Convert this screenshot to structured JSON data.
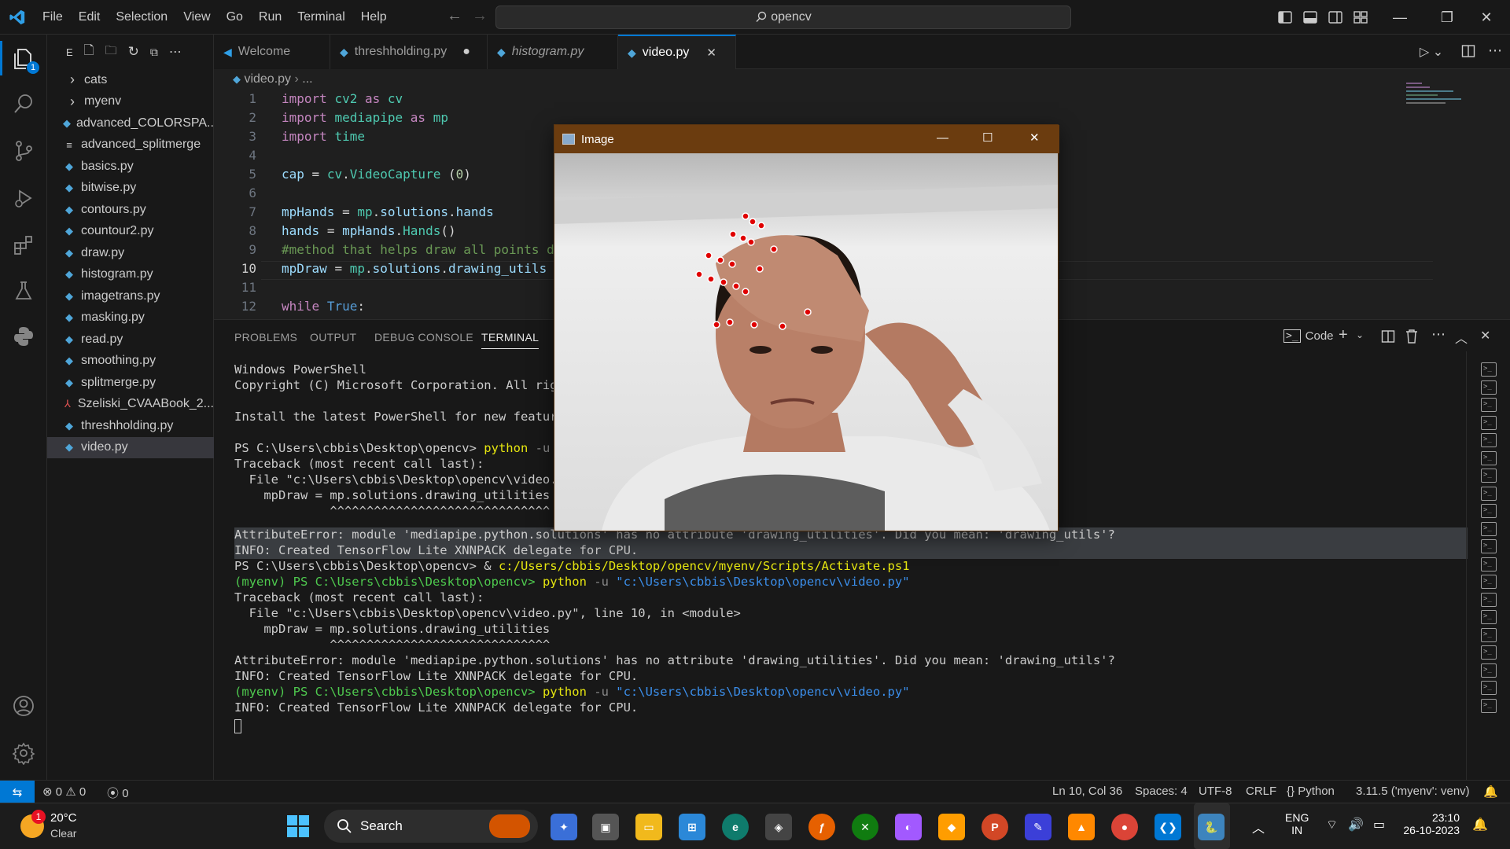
{
  "menu": [
    "File",
    "Edit",
    "Selection",
    "View",
    "Go",
    "Run",
    "Terminal",
    "Help"
  ],
  "command_center": "opencv",
  "sidebar": {
    "header_letter": "E",
    "items": [
      {
        "label": "cats",
        "kind": "folder"
      },
      {
        "label": "myenv",
        "kind": "folder"
      },
      {
        "label": "advanced_COLORSPA...",
        "kind": "python"
      },
      {
        "label": "advanced_splitmerge",
        "kind": "text"
      },
      {
        "label": "basics.py",
        "kind": "python"
      },
      {
        "label": "bitwise.py",
        "kind": "python"
      },
      {
        "label": "contours.py",
        "kind": "python"
      },
      {
        "label": "countour2.py",
        "kind": "python"
      },
      {
        "label": "draw.py",
        "kind": "python"
      },
      {
        "label": "histogram.py",
        "kind": "python"
      },
      {
        "label": "imagetrans.py",
        "kind": "python"
      },
      {
        "label": "masking.py",
        "kind": "python"
      },
      {
        "label": "read.py",
        "kind": "python"
      },
      {
        "label": "smoothing.py",
        "kind": "python"
      },
      {
        "label": "splitmerge.py",
        "kind": "python"
      },
      {
        "label": "Szeliski_CVAABook_2...",
        "kind": "pdf"
      },
      {
        "label": "threshholding.py",
        "kind": "python"
      },
      {
        "label": "video.py",
        "kind": "python"
      }
    ]
  },
  "tabs": [
    {
      "label": "Welcome"
    },
    {
      "label": "threshholding.py",
      "modified": "●"
    },
    {
      "label": "histogram.py"
    },
    {
      "label": "video.py",
      "close": "✕"
    }
  ],
  "breadcrumb": {
    "file": "video.py",
    "rest": "..."
  },
  "editor": {
    "line_numbers": [
      "1",
      "2",
      "3",
      "4",
      "5",
      "6",
      "7",
      "8",
      "9",
      "10",
      "11",
      "12"
    ],
    "current_line": "10"
  },
  "panel": {
    "tabs": [
      "PROBLEMS",
      "OUTPUT",
      "DEBUG CONSOLE",
      "TERMINAL"
    ],
    "terminal_label": "Code",
    "lines": {
      "l1": "Windows PowerShell",
      "l2": "Copyright (C) Microsoft Corporation. All righ",
      "l3": "Install the latest PowerShell for new feature",
      "l4_prompt": "PS C:\\Users\\cbbis\\Desktop\\opencv> ",
      "l4_cmd": "python",
      "l4_flag": " -u ",
      "l4_path": "\"",
      "l5": "Traceback (most recent call last):",
      "l6": "  File \"c:\\Users\\cbbis\\Desktop\\opencv\\video.p",
      "l7": "    mpDraw = mp.solutions.drawing_utilities",
      "l8": "             ^^^^^^^^^^^^^^^^^^^^^^^^^^^^^^",
      "l9": "AttributeError: module 'mediapipe.python.solutions' has no attribute 'drawing_utilities'. Did you mean: 'drawing_utils'?",
      "l10": "INFO: Created TensorFlow Lite XNNPACK delegate for CPU.",
      "l11_prompt": "PS C:\\Users\\cbbis\\Desktop\\opencv> & ",
      "l11_path": "c:/Users/cbbis/Desktop/opencv/myenv/Scripts/Activate.ps1",
      "l12_prompt": "(myenv) PS C:\\Users\\cbbis\\Desktop\\opencv> ",
      "l12_cmd": "python",
      "l12_flag": " -u ",
      "l12_path": "\"c:\\Users\\cbbis\\Desktop\\opencv\\video.py\"",
      "l13": "Traceback (most recent call last):",
      "l14": "  File \"c:\\Users\\cbbis\\Desktop\\opencv\\video.py\", line 10, in <module>",
      "l15": "    mpDraw = mp.solutions.drawing_utilities",
      "l16": "             ^^^^^^^^^^^^^^^^^^^^^^^^^^^^^^",
      "l17": "AttributeError: module 'mediapipe.python.solutions' has no attribute 'drawing_utilities'. Did you mean: 'drawing_utils'?",
      "l18": "INFO: Created TensorFlow Lite XNNPACK delegate for CPU.",
      "l19_prompt": "(myenv) PS C:\\Users\\cbbis\\Desktop\\opencv> ",
      "l19_cmd": "python",
      "l19_flag": " -u ",
      "l19_path": "\"c:\\Users\\cbbis\\Desktop\\opencv\\video.py\"",
      "l20": "INFO: Created TensorFlow Lite XNNPACK delegate for CPU."
    }
  },
  "statusbar": {
    "errors": "0",
    "warnings": "0",
    "ports": "0",
    "position": "Ln 10, Col 36",
    "spaces": "Spaces: 4",
    "encoding": "UTF-8",
    "eol": "CRLF",
    "language": "Python",
    "interpreter": "3.11.5 ('myenv': venv)"
  },
  "image_window": {
    "title": "Image"
  },
  "taskbar": {
    "weather_temp": "20°C",
    "weather_desc": "Clear",
    "weather_badge": "1",
    "search_label": "Search",
    "lang_top": "ENG",
    "lang_bottom": "IN",
    "time": "23:10",
    "date": "26-10-2023"
  },
  "explorer_badge": "1",
  "colors": {
    "accent": "#0078d4",
    "image_title": "#6b3c0f",
    "landmark": "#e00000"
  }
}
